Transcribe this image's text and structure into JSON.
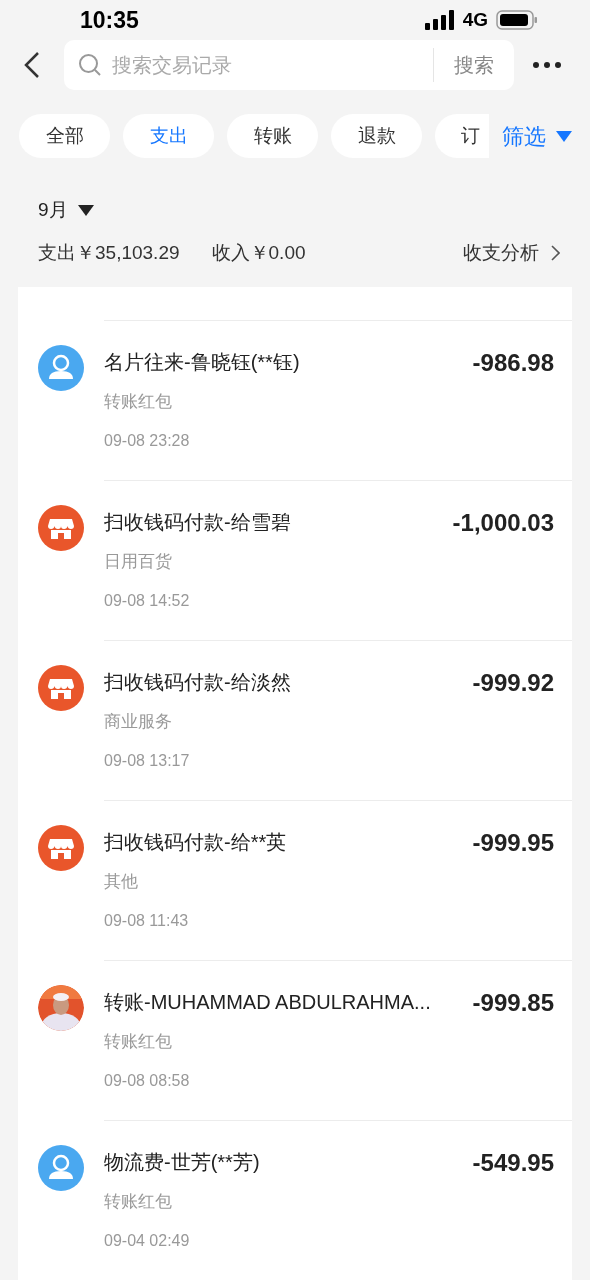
{
  "status_bar": {
    "time": "10:35",
    "network": "4G"
  },
  "search": {
    "placeholder": "搜索交易记录",
    "button": "搜索"
  },
  "chips": [
    {
      "label": "全部",
      "selected": false
    },
    {
      "label": "支出",
      "selected": true
    },
    {
      "label": "转账",
      "selected": false
    },
    {
      "label": "退款",
      "selected": false
    },
    {
      "label": "订",
      "selected": false
    }
  ],
  "filter": "筛选",
  "month": "9月",
  "summary": {
    "expense": "支出￥35,103.29",
    "income": "收入￥0.00",
    "analysis": "收支分析"
  },
  "transactions": [
    {
      "kind": "person",
      "title": "名片往来-鲁晓钰(**钰)",
      "category": "转账红包",
      "time": "09-08 23:28",
      "amount": "-986.98"
    },
    {
      "kind": "shop",
      "title": "扫收钱码付款-给雪碧",
      "category": "日用百货",
      "time": "09-08 14:52",
      "amount": "-1,000.03"
    },
    {
      "kind": "shop",
      "title": "扫收钱码付款-给淡然",
      "category": "商业服务",
      "time": "09-08 13:17",
      "amount": "-999.92"
    },
    {
      "kind": "shop",
      "title": "扫收钱码付款-给**英",
      "category": "其他",
      "time": "09-08 11:43",
      "amount": "-999.95"
    },
    {
      "kind": "picture",
      "title": "转账-MUHAMMAD ABDULRAHMA...",
      "category": "转账红包",
      "time": "09-08 08:58",
      "amount": "-999.85"
    },
    {
      "kind": "person",
      "title": "物流费-世芳(**芳)",
      "category": "转账红包",
      "time": "09-04 02:49",
      "amount": "-549.95"
    }
  ]
}
